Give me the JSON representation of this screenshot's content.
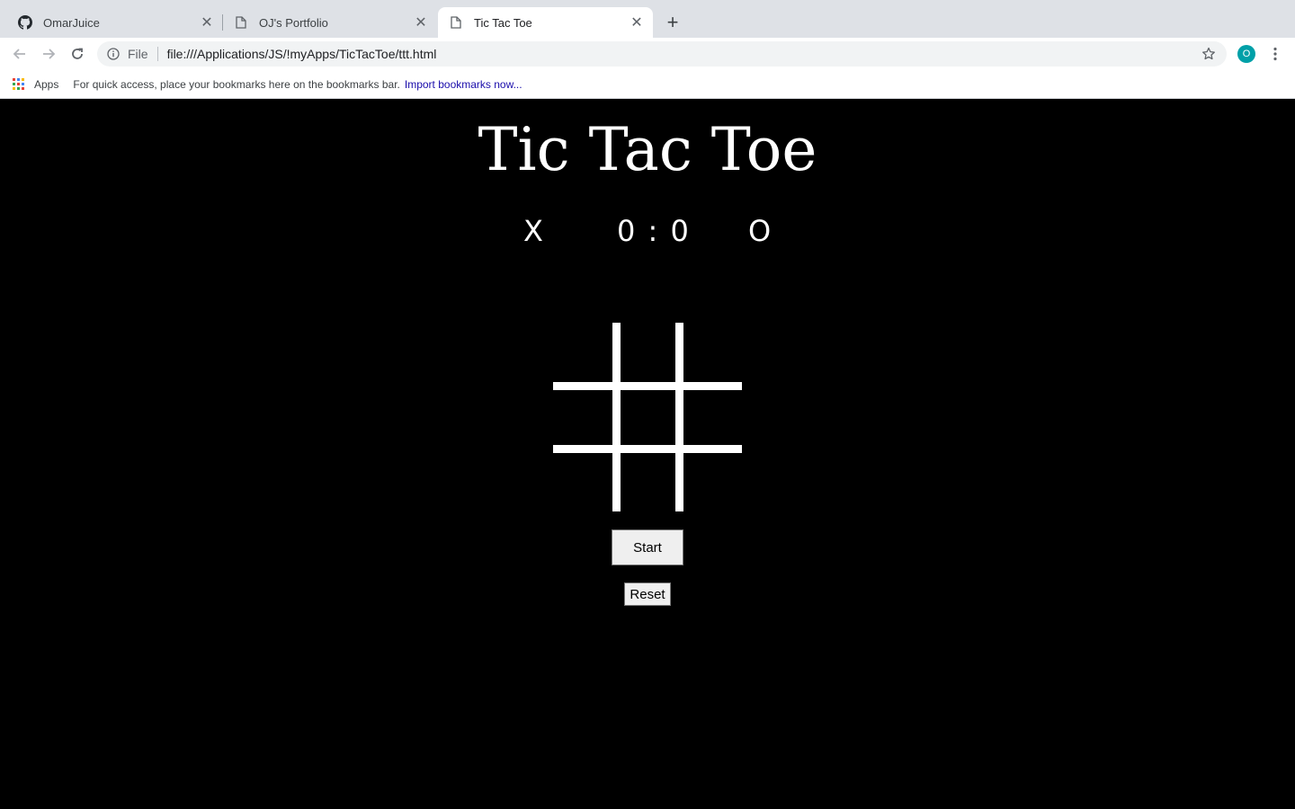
{
  "browser": {
    "tabs": [
      {
        "title": "OmarJuice",
        "icon": "github-icon",
        "active": false
      },
      {
        "title": "OJ's Portfolio",
        "icon": "document-icon",
        "active": false
      },
      {
        "title": "Tic Tac Toe",
        "icon": "document-icon",
        "active": true
      }
    ],
    "omnibox": {
      "scheme_label": "File",
      "url": "file:///Applications/JS/!myApps/TicTacToe/ttt.html"
    },
    "profile_initial": "O",
    "bookmarks_bar": {
      "apps_label": "Apps",
      "hint": "For quick access, place your bookmarks here on the bookmarks bar.",
      "import_link": "Import bookmarks now..."
    }
  },
  "game": {
    "title": "Tic Tac Toe",
    "score": {
      "player_x": "X",
      "value": "0 : 0",
      "player_o": "O"
    },
    "board": [
      "",
      "",
      "",
      "",
      "",
      "",
      "",
      "",
      ""
    ],
    "buttons": {
      "start": "Start",
      "reset": "Reset"
    }
  },
  "colors": {
    "page_background": "#000000",
    "foreground": "#ffffff",
    "profile_avatar": "#00a0a8",
    "link": "#1a0dab"
  }
}
